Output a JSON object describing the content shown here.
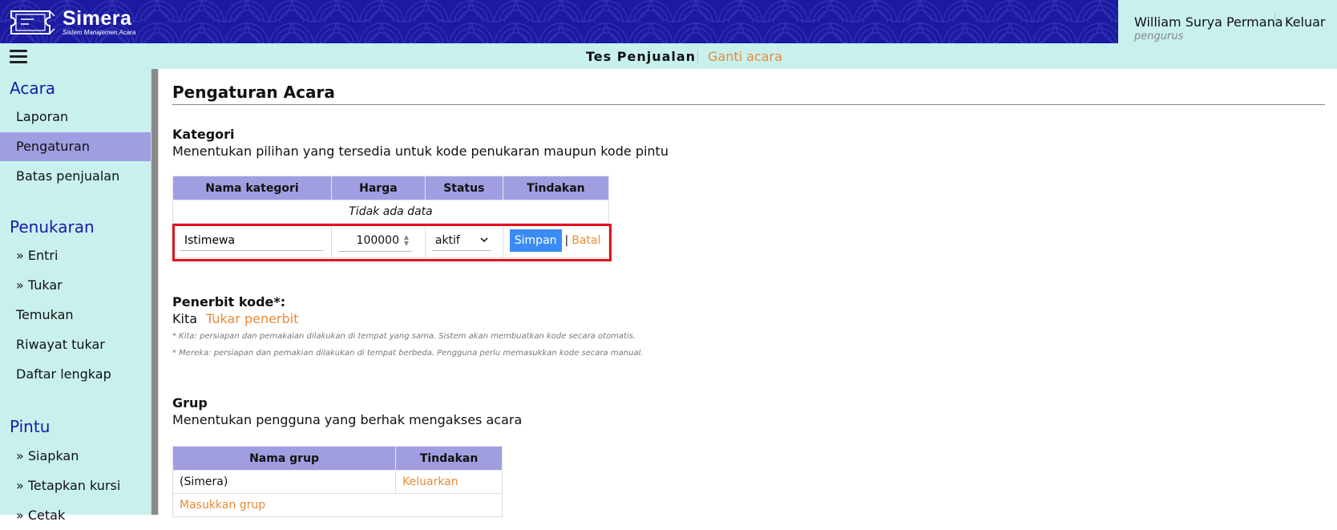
{
  "brand": {
    "name": "Simera",
    "tagline": "Sistem Manajemen Acara"
  },
  "user": {
    "name": "William Surya Permana",
    "role": "pengurus",
    "logout_label": "Keluar"
  },
  "subbar": {
    "event_name": "Tes Penjualan",
    "change_event_label": "Ganti acara"
  },
  "sidebar": {
    "sections": [
      {
        "title": "Acara",
        "items": [
          "Laporan",
          "Pengaturan",
          "Batas penjualan"
        ]
      },
      {
        "title": "Penukaran",
        "items": [
          "» Entri",
          "» Tukar",
          "Temukan",
          "Riwayat tukar",
          "Daftar lengkap"
        ]
      },
      {
        "title": "Pintu",
        "items": [
          "» Siapkan",
          "» Tetapkan kursi",
          "» Cetak"
        ]
      }
    ],
    "active_item": "Pengaturan"
  },
  "page": {
    "title": "Pengaturan Acara"
  },
  "kategori": {
    "heading": "Kategori",
    "description": "Menentukan pilihan yang tersedia untuk kode penukaran maupun kode pintu",
    "columns": [
      "Nama kategori",
      "Harga",
      "Status",
      "Tindakan"
    ],
    "empty_text": "Tidak ada data",
    "edit_row": {
      "name_value": "Istimewa",
      "price_value": "100000",
      "status_value": "aktif",
      "save_label": "Simpan",
      "separator": "|",
      "cancel_label": "Batal"
    }
  },
  "penerbit": {
    "heading": "Penerbit kode*:",
    "current": "Kita",
    "switch_label": "Tukar penerbit",
    "note1": "* Kita: persiapan dan pemakaian dilakukan di tempat yang sama. Sistem akan membuatkan kode secara otomatis.",
    "note2": "* Mereka: persiapan dan pemakian dilakukan di tempat berbeda. Pengguna perlu memasukkan kode secara manual."
  },
  "grup": {
    "heading": "Grup",
    "description": "Menentukan pengguna yang berhak mengakses acara",
    "columns": [
      "Nama grup",
      "Tindakan"
    ],
    "rows": [
      {
        "name": "(Simera)",
        "action": "Keluarkan"
      }
    ],
    "add_label": "Masukkan grup"
  },
  "colors": {
    "header_bg": "#1b1aa0",
    "accent_bg": "#c8f1ee",
    "table_header": "#a09ee0",
    "link": "#e98a36",
    "primary_button": "#3b8bf5",
    "highlight_border": "#e0141e"
  },
  "icons": [
    "ticket-logo-icon",
    "hamburger-menu-icon",
    "chevron-down-icon",
    "number-stepper-icon"
  ]
}
